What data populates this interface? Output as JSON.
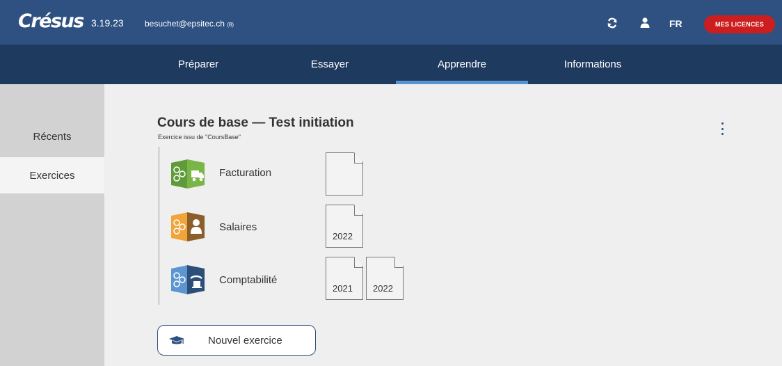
{
  "header": {
    "logo": "Crésus",
    "version": "3.19.23",
    "email": "besuchet@epsitec.ch",
    "email_badge": "(8)",
    "refresh_icon": "refresh-icon",
    "user_icon": "user-icon",
    "language": "FR",
    "licences_label": "MES LICENCES",
    "colors": {
      "topbar": "#2f5182",
      "navbar": "#1f3a5f",
      "accent": "#cc1e1e",
      "active_tab": "#5b92d0"
    }
  },
  "nav": {
    "tabs": [
      {
        "label": "Préparer"
      },
      {
        "label": "Essayer"
      },
      {
        "label": "Apprendre",
        "active": true
      },
      {
        "label": "Informations"
      }
    ]
  },
  "sidebar": {
    "items": [
      {
        "label": "Récents"
      },
      {
        "label": "Exercices",
        "active": true
      }
    ]
  },
  "main": {
    "title": "Cours de base — Test initiation",
    "subtitle": "Exercice issu de \"CoursBase\"",
    "menu_icon": "more-vertical-icon",
    "apps": [
      {
        "label": "Facturation",
        "icon": "facturation-icon",
        "color": "#5f9b39",
        "documents": [
          ""
        ]
      },
      {
        "label": "Salaires",
        "icon": "salaires-icon",
        "color": "#f0a43a",
        "documents": [
          "2022"
        ]
      },
      {
        "label": "Comptabilité",
        "icon": "comptabilite-icon",
        "color": "#5c95d0",
        "documents": [
          "2021",
          "2022"
        ]
      }
    ],
    "new_button": {
      "label": "Nouvel exercice",
      "icon": "graduation-cap-icon"
    }
  }
}
